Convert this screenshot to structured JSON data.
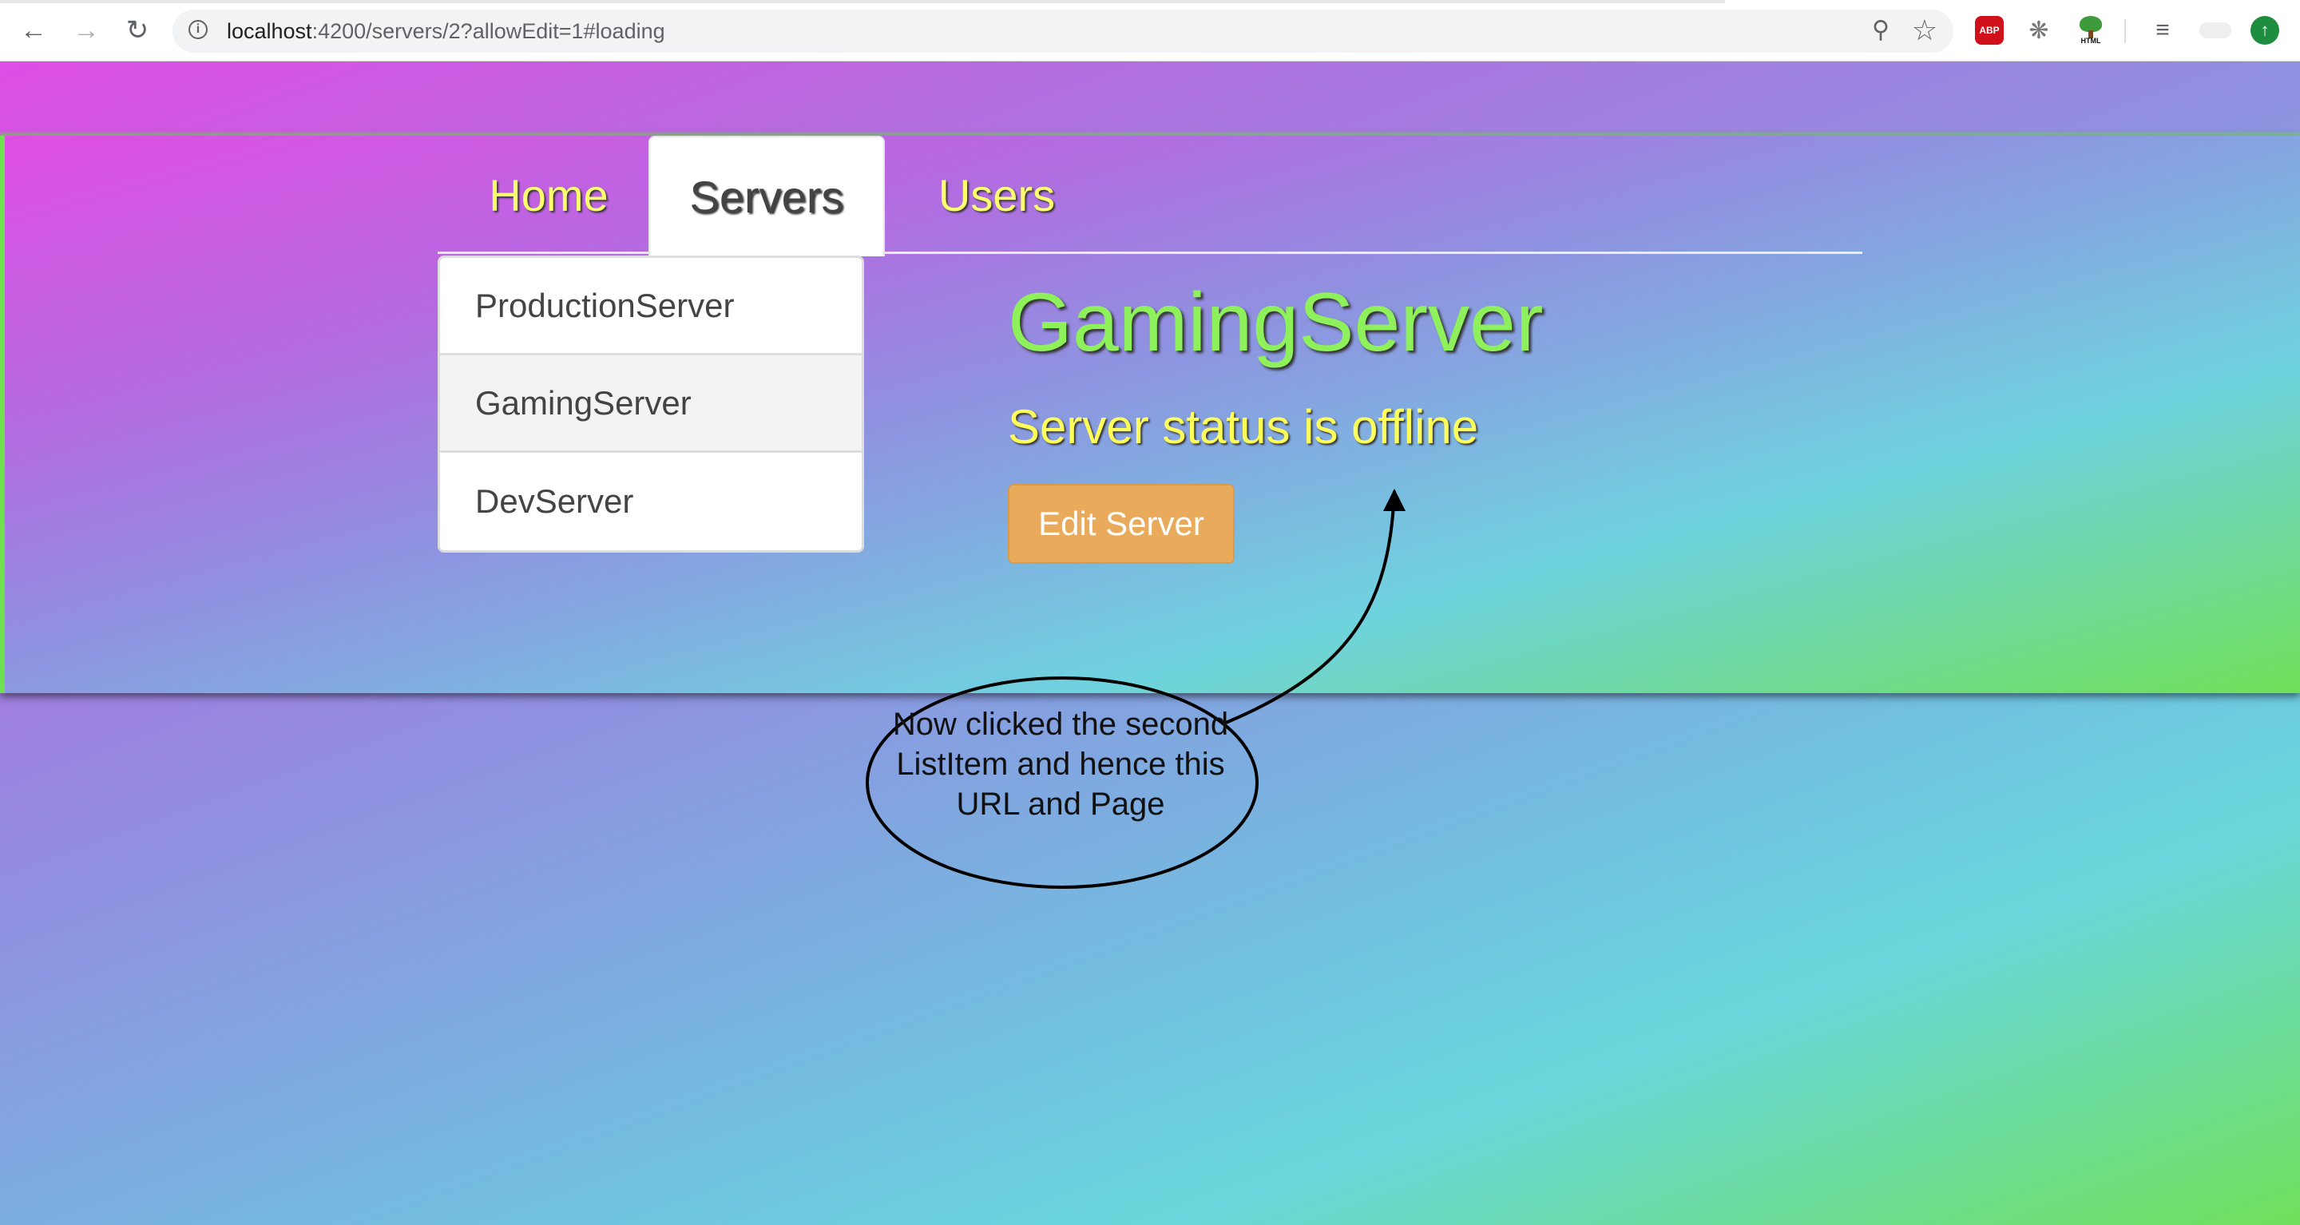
{
  "browser": {
    "url_host": "localhost",
    "url_path": ":4200/servers/2?allowEdit=1#loading",
    "icons": {
      "back": "arrow-left-icon",
      "forward": "arrow-right-icon",
      "reload": "reload-icon",
      "info": "info-icon",
      "zoom": "zoom-icon",
      "bookmark": "star-icon"
    },
    "extensions": {
      "abp_label": "ABP",
      "html_label": "HTML"
    }
  },
  "nav": {
    "tabs": [
      {
        "label": "Home"
      },
      {
        "label": "Servers"
      },
      {
        "label": "Users"
      }
    ],
    "active_tab": "Servers"
  },
  "servers": {
    "items": [
      {
        "label": "ProductionServer"
      },
      {
        "label": "GamingServer"
      },
      {
        "label": "DevServer"
      }
    ],
    "selected": "GamingServer"
  },
  "detail": {
    "title": "GamingServer",
    "status_text": "Server status is offline",
    "edit_button": "Edit Server"
  },
  "annotation": {
    "text": "Now clicked the second ListItem and hence this URL and Page"
  },
  "colors": {
    "title": "#8ef05a",
    "status": "#ffff5a",
    "tab_text": "#ffff6e",
    "edit_button": "#e9ab5b"
  }
}
